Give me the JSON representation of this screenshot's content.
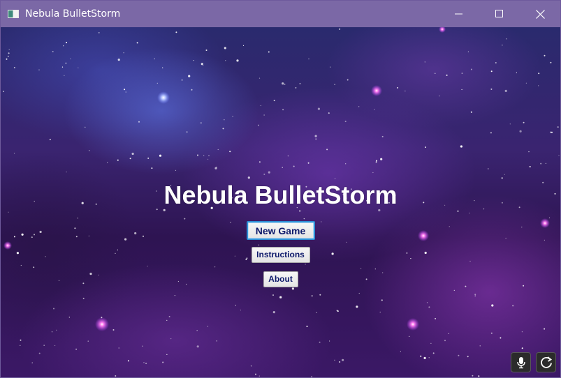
{
  "window": {
    "title": "Nebula BulletStorm",
    "app_icon": "app-window-icon",
    "titlebar_color": "#7b68a6",
    "controls": [
      "minimize-icon",
      "maximize-icon",
      "close-icon"
    ]
  },
  "game": {
    "title": "Nebula BulletStorm",
    "menu": {
      "new_game": "New Game",
      "instructions": "Instructions",
      "about": "About"
    },
    "overlay_buttons": [
      "microphone-icon",
      "refresh-icon"
    ]
  },
  "colors": {
    "button_text": "#0e1a6b",
    "focus_ring": "#2d8fd6",
    "title_text": "#ffffff"
  }
}
